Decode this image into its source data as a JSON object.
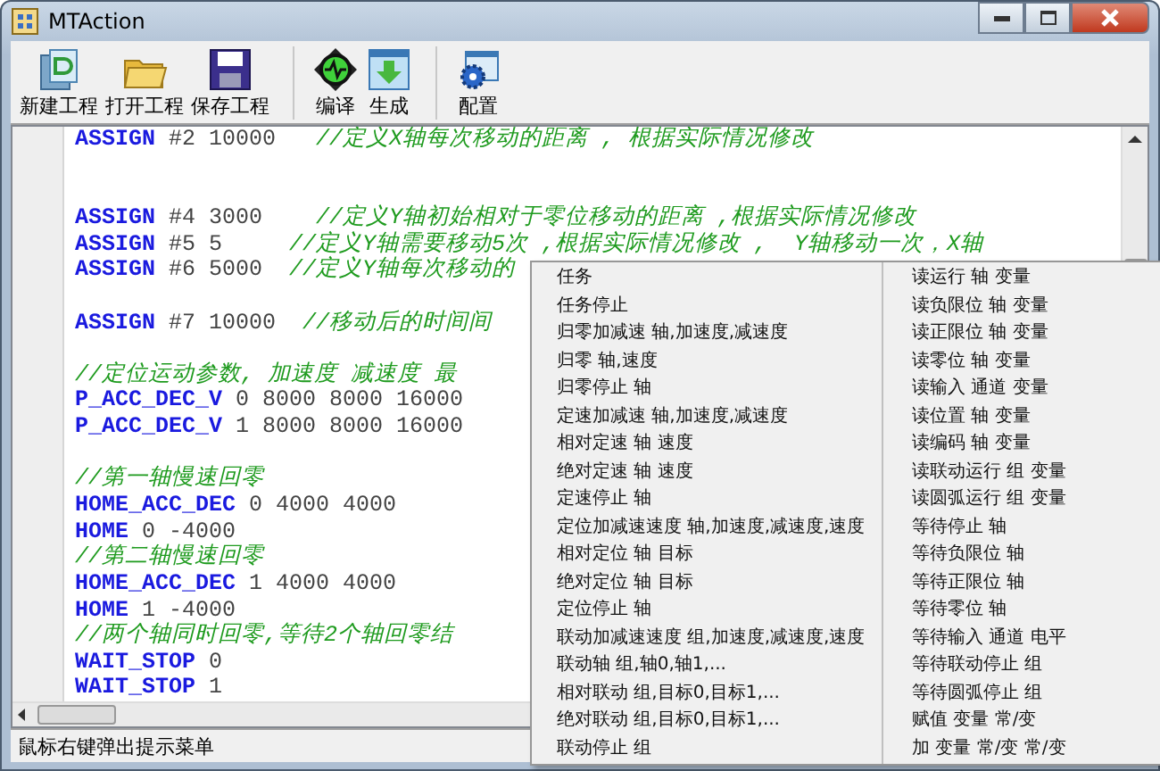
{
  "window": {
    "title": "MTAction"
  },
  "toolbar": [
    {
      "kind": "new",
      "label": "新建工程"
    },
    {
      "kind": "open",
      "label": "打开工程"
    },
    {
      "kind": "save",
      "label": "保存工程"
    },
    {
      "kind": "compile",
      "label": "编译"
    },
    {
      "kind": "build",
      "label": "生成"
    },
    {
      "kind": "config",
      "label": "配置"
    }
  ],
  "code_lines": [
    {
      "tokens": [
        {
          "kind": "keyword",
          "text": "ASSIGN"
        },
        {
          "kind": "value",
          "text": " #2 10000   "
        },
        {
          "kind": "comment",
          "text": "//定义X轴每次移动的距离 , 根据实际情况修改"
        }
      ]
    },
    {
      "kind": "wide",
      "tokens": [
        {
          "kind": "keyword",
          "text": "ASSIGN"
        },
        {
          "kind": "value",
          "text": " #4 3000    "
        },
        {
          "kind": "comment",
          "text": "//定义Y轴初始相对于零位移动的距离 ,根据实际情况修改"
        }
      ]
    },
    {
      "tokens": [
        {
          "kind": "keyword",
          "text": "ASSIGN"
        },
        {
          "kind": "value",
          "text": " #5 5     "
        },
        {
          "kind": "comment",
          "text": "//定义Y轴需要移动5次 ,根据实际情况修改 ,  Y轴移动一次，X轴"
        }
      ]
    },
    {
      "tokens": [
        {
          "kind": "keyword",
          "text": "ASSIGN"
        },
        {
          "kind": "value",
          "text": " #6 5000  "
        },
        {
          "kind": "comment",
          "text": "//定义Y轴每次移动的"
        }
      ]
    },
    {
      "kind": "spaced",
      "tokens": [
        {
          "kind": "keyword",
          "text": "ASSIGN"
        },
        {
          "kind": "value",
          "text": " #7 10000  "
        },
        {
          "kind": "comment",
          "text": "//移动后的时间间"
        }
      ]
    },
    {
      "kind": "spaced",
      "tokens": [
        {
          "kind": "comment",
          "text": "//定位运动参数, 加速度 减速度 最"
        }
      ]
    },
    {
      "tokens": [
        {
          "kind": "keyword",
          "text": "P_ACC_DEC_V"
        },
        {
          "kind": "value",
          "text": " 0 8000 8000 16000"
        }
      ]
    },
    {
      "tokens": [
        {
          "kind": "keyword",
          "text": "P_ACC_DEC_V"
        },
        {
          "kind": "value",
          "text": " 1 8000 8000 16000"
        }
      ]
    },
    {
      "kind": "spaced",
      "tokens": [
        {
          "kind": "comment",
          "text": "//第一轴慢速回零"
        }
      ]
    },
    {
      "tokens": [
        {
          "kind": "keyword",
          "text": "HOME_ACC_DEC"
        },
        {
          "kind": "value",
          "text": " 0 4000 4000"
        }
      ]
    },
    {
      "tokens": [
        {
          "kind": "keyword",
          "text": "HOME"
        },
        {
          "kind": "value",
          "text": " 0 -4000"
        }
      ]
    },
    {
      "tokens": [
        {
          "kind": "comment",
          "text": "//第二轴慢速回零"
        }
      ]
    },
    {
      "tokens": [
        {
          "kind": "keyword",
          "text": "HOME_ACC_DEC"
        },
        {
          "kind": "value",
          "text": " 1 4000 4000"
        }
      ]
    },
    {
      "tokens": [
        {
          "kind": "keyword",
          "text": "HOME"
        },
        {
          "kind": "value",
          "text": " 1 -4000"
        }
      ]
    },
    {
      "tokens": [
        {
          "kind": "comment",
          "text": "//两个轴同时回零,等待2个轴回零结"
        }
      ]
    },
    {
      "tokens": [
        {
          "kind": "keyword",
          "text": "WAIT_STOP"
        },
        {
          "kind": "value",
          "text": " 0"
        }
      ]
    },
    {
      "tokens": [
        {
          "kind": "keyword",
          "text": "WAIT_STOP"
        },
        {
          "kind": "value",
          "text": " 1"
        }
      ]
    }
  ],
  "status_bar": "鼠标右键弹出提示菜单",
  "context_menu": {
    "left": [
      "任务",
      "任务停止",
      "归零加减速 轴,加速度,减速度",
      "归零 轴,速度",
      "归零停止 轴",
      "定速加减速 轴,加速度,减速度",
      "相对定速 轴 速度",
      "绝对定速 轴 速度",
      "定速停止 轴",
      "定位加减速速度 轴,加速度,减速度,速度",
      "相对定位 轴 目标",
      "绝对定位 轴 目标",
      "定位停止 轴",
      "联动加减速速度 组,加速度,减速度,速度",
      "联动轴 组,轴0,轴1,...",
      "相对联动 组,目标0,目标1,...",
      "绝对联动 组,目标0,目标1,...",
      "联动停止 组"
    ],
    "right": [
      "读运行 轴 变量",
      "读负限位 轴 变量",
      "读正限位 轴 变量",
      "读零位 轴 变量",
      "读输入 通道 变量",
      "读位置 轴 变量",
      "读编码 轴 变量",
      "读联动运行 组 变量",
      "读圆弧运行 组 变量",
      "等待停止 轴",
      "等待负限位 轴",
      "等待正限位 轴",
      "等待零位 轴",
      "等待输入 通道 电平",
      "等待联动停止 组",
      "等待圆弧停止 组",
      "赋值 变量 常/变",
      "加 变量 常/变 常/变"
    ]
  }
}
